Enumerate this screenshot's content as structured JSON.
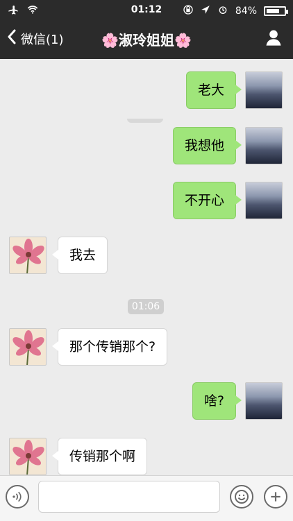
{
  "status": {
    "time": "01:12",
    "battery_percent_text": "84%",
    "battery_level": 0.84,
    "icons": [
      "airplane-icon",
      "wifi-icon",
      "rotation-lock-icon",
      "location-icon",
      "alarm-icon",
      "battery-icon"
    ]
  },
  "nav": {
    "back_label": "微信(1)",
    "title": "🌸淑玲姐姐🌸",
    "profile_icon": "profile-icon"
  },
  "messages": [
    {
      "side": "me",
      "text": "老大"
    },
    {
      "side": "me",
      "text": "我想他"
    },
    {
      "side": "me",
      "text": "不开心"
    },
    {
      "side": "friend",
      "text": "我去"
    },
    {
      "side": "friend",
      "text": "那个传销那个?"
    },
    {
      "side": "me",
      "text": "啥?"
    },
    {
      "side": "friend",
      "text": "传销那个啊"
    }
  ],
  "timestamp": "01:06",
  "composer": {
    "input_value": "",
    "icons": [
      "voice-icon",
      "emoji-icon",
      "plus-icon"
    ]
  },
  "colors": {
    "topbar": "#2b2b2b",
    "chat_bg": "#ececec",
    "my_bubble": "#9fe57a",
    "friend_bubble": "#ffffff"
  }
}
